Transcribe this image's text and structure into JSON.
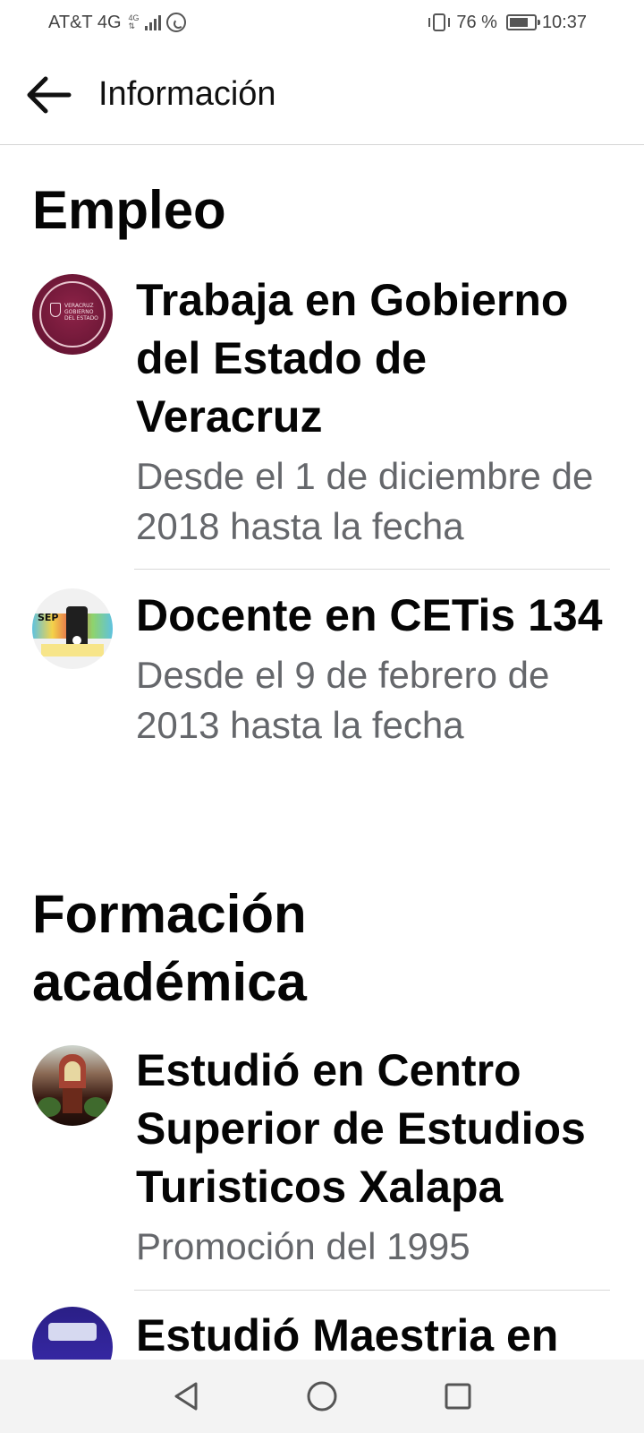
{
  "status_bar": {
    "carrier": "AT&T 4G",
    "network_small": "4G",
    "battery_percent": "76 %",
    "battery_level": 0.76,
    "time": "10:37",
    "icons": [
      "signal-bars-icon",
      "whatsapp-icon",
      "vibrate-icon",
      "battery-icon"
    ]
  },
  "header": {
    "title": "Información",
    "back_icon": "arrow-left-icon"
  },
  "sections": {
    "employment": {
      "title": "Empleo",
      "items": [
        {
          "title": "Trabaja en Gobierno del Estado de Veracruz",
          "subtitle": "Desde el 1 de diciembre de 2018 hasta la fecha",
          "avatar_label": "VERACRUZ GOBIERNO DEL ESTADO"
        },
        {
          "title": "Docente en CETis 134",
          "subtitle": "Desde el 9 de febrero de 2013 hasta la fecha",
          "avatar_label": "SEP"
        }
      ]
    },
    "education": {
      "title": "Formación académica",
      "items": [
        {
          "title": "Estudió en Centro Superior de Estudios Turisticos Xalapa",
          "subtitle": "Promoción del 1995"
        },
        {
          "title": "Estudió Maestria en"
        }
      ]
    }
  },
  "nav_bar": {
    "icons": [
      "back-triangle-icon",
      "home-circle-icon",
      "recents-square-icon"
    ]
  },
  "colors": {
    "text_primary": "#050505",
    "text_secondary": "#65676b",
    "divider": "#d9d9d9",
    "nav_background": "#f3f3f3"
  }
}
